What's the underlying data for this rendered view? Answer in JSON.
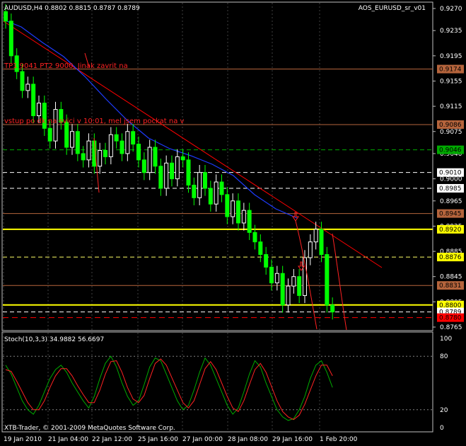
{
  "header": {
    "symbol_info": "AUDUSD,H4  0.8802 0.8815 0.8787 0.8789",
    "indicator_name": "AOS_EURUSD_sr_v01"
  },
  "annotations": {
    "note1": "TP1 9041 PT2 9000, Jinak zavrit na",
    "note2": "vstup po dk na svici v 10:01, mel jsem pockat na v"
  },
  "stoch_panel": {
    "label": "Stoch(10,3,3) 34.9882 56.6697",
    "copyright": "XTB-Trader, © 2001-2009 MetaQuotes Software Corp.",
    "levels": [
      "100",
      "80",
      "20",
      "0"
    ]
  },
  "price_axis": [
    "0.9270",
    "0.9235",
    "0.9195",
    "0.9155",
    "0.9115",
    "0.9075",
    "0.9040",
    "0.9000",
    "0.8965",
    "0.8925",
    "0.8885",
    "0.8845",
    "0.8805",
    "0.8765"
  ],
  "time_axis": [
    "19 Jan 2010",
    "21 Jan 04:00",
    "22 Jan 12:00",
    "25 Jan 16:00",
    "27 Jan 00:00",
    "28 Jan 08:00",
    "29 Jan 16:00",
    "1 Feb 20:00"
  ],
  "levels": [
    {
      "price": "0.9174",
      "color": "#b5643c"
    },
    {
      "price": "0.9086",
      "color": "#b5643c"
    },
    {
      "price": "0.9046",
      "color": "#00aa00"
    },
    {
      "price": "0.9010",
      "color": "#ffffff"
    },
    {
      "price": "0.8985",
      "color": "#ffffff"
    },
    {
      "price": "0.8945",
      "color": "#b5643c"
    },
    {
      "price": "0.8920",
      "color": "#ffff00"
    },
    {
      "price": "0.8876",
      "color": "#ffff66"
    },
    {
      "price": "0.8831",
      "color": "#b5643c"
    },
    {
      "price": "0.8800",
      "color": "#ffff00"
    },
    {
      "price": "0.8789",
      "color": "#ffffff"
    },
    {
      "price": "0.8780",
      "color": "#ff0000"
    }
  ],
  "colors": {
    "up": "#ffffff",
    "down": "#00ff00",
    "bull_fill": "#000000",
    "ma": "#1e3cff",
    "trend": "#ff0000"
  }
}
